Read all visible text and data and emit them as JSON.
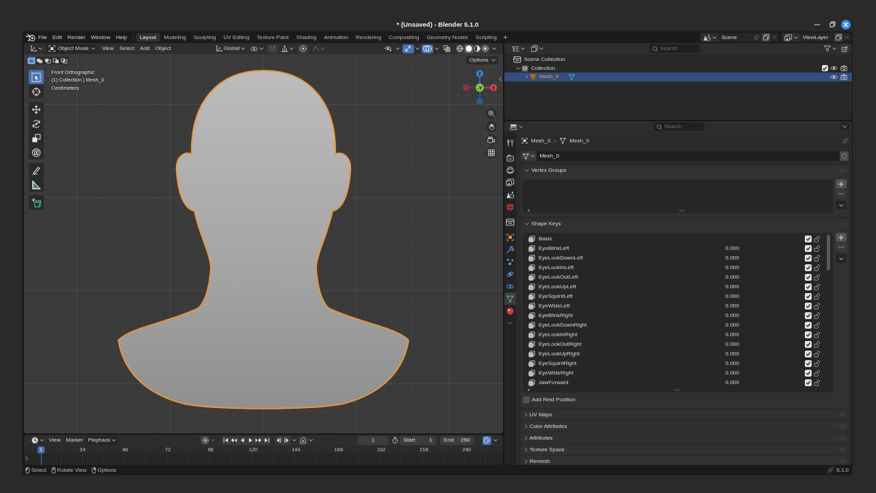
{
  "window": {
    "title": "* (Unsaved) - Blender 5.1.0"
  },
  "topbar": {
    "menus": [
      "File",
      "Edit",
      "Render",
      "Window",
      "Help"
    ],
    "workspaces": [
      {
        "label": "Layout",
        "selected": true
      },
      {
        "label": "Modeling",
        "selected": false
      },
      {
        "label": "Sculpting",
        "selected": false
      },
      {
        "label": "UV Editing",
        "selected": false
      },
      {
        "label": "Texture Paint",
        "selected": false
      },
      {
        "label": "Shading",
        "selected": false
      },
      {
        "label": "Animation",
        "selected": false
      },
      {
        "label": "Rendering",
        "selected": false
      },
      {
        "label": "Compositing",
        "selected": false
      },
      {
        "label": "Geometry Nodes",
        "selected": false
      },
      {
        "label": "Scripting",
        "selected": false
      }
    ],
    "add_tab": "+",
    "scene": "Scene",
    "view_layer": "ViewLayer"
  },
  "viewport": {
    "mode": "Object Mode",
    "menus": [
      "View",
      "Select",
      "Add",
      "Object"
    ],
    "orientation": "Global",
    "toggles": [
      {
        "kind": "selectability",
        "on": false
      },
      {
        "kind": "gizmos",
        "on": true
      },
      {
        "kind": "overlays",
        "on": true
      },
      {
        "kind": "xray",
        "on": false
      }
    ],
    "shading": [
      {
        "kind": "wireframe",
        "selected": false
      },
      {
        "kind": "solid",
        "selected": true
      },
      {
        "kind": "material",
        "selected": false
      },
      {
        "kind": "rendered",
        "selected": false
      }
    ],
    "select_modes": [
      {
        "kind": "set",
        "selected": true
      },
      {
        "kind": "extend",
        "selected": false
      },
      {
        "kind": "subtract",
        "selected": false
      },
      {
        "kind": "invert",
        "selected": false
      },
      {
        "kind": "intersect",
        "selected": false
      }
    ],
    "options": "Options",
    "info": [
      "Front Orthographic",
      "(1) Collection | Mesh_0",
      "Centimeters"
    ],
    "tools": [
      {
        "kind": "select_box",
        "selected": true
      },
      {
        "kind": "cursor",
        "selected": false
      },
      {
        "kind": "move",
        "selected": false
      },
      {
        "kind": "rotate",
        "selected": false
      },
      {
        "kind": "scale",
        "selected": false
      },
      {
        "kind": "transform",
        "selected": false
      },
      {
        "kind": "annotate",
        "selected": false
      },
      {
        "kind": "measure",
        "selected": false
      },
      {
        "kind": "add_cube",
        "selected": false
      }
    ],
    "axes": [
      {
        "kind": "up",
        "label": "Z",
        "color": "#3d86d8"
      },
      {
        "kind": "left",
        "color": "#8e3242"
      },
      {
        "kind": "center",
        "label": "-Y",
        "color": "#8cc63f"
      },
      {
        "kind": "right",
        "label": "X",
        "color": "#e0455a"
      },
      {
        "kind": "down",
        "color": "#2d5b95"
      }
    ]
  },
  "outliner": {
    "search": {
      "placeholder": "Search"
    },
    "tree": [
      {
        "kind": "scene_collection",
        "label": "Scene Collection",
        "selected": false,
        "children": [
          {
            "kind": "collection",
            "label": "Collection",
            "expanded": true,
            "checked": true,
            "selected": false,
            "children": [
              {
                "kind": "mesh_object",
                "label": "Mesh_0",
                "expanded": false,
                "selected": true
              }
            ]
          }
        ]
      }
    ]
  },
  "properties": {
    "search": {
      "placeholder": "Search"
    },
    "tabs": [
      {
        "kind": "tool",
        "selected": false
      },
      {
        "kind": "render",
        "selected": false
      },
      {
        "kind": "output",
        "selected": false
      },
      {
        "kind": "view_layer",
        "selected": false
      },
      {
        "kind": "scene",
        "selected": false
      },
      {
        "kind": "world",
        "selected": false
      },
      {
        "kind": "collection",
        "selected": false
      },
      {
        "kind": "object",
        "selected": false
      },
      {
        "kind": "modifiers",
        "selected": false
      },
      {
        "kind": "particles",
        "selected": false
      },
      {
        "kind": "physics",
        "selected": false
      },
      {
        "kind": "constraints",
        "selected": false
      },
      {
        "kind": "data",
        "selected": true
      },
      {
        "kind": "material",
        "selected": false
      }
    ],
    "breadcrumb": [
      "Mesh_0",
      "Mesh_0"
    ],
    "datablock": "Mesh_0",
    "panels": [
      {
        "title": "Vertex Groups",
        "expanded": true,
        "kind": "list"
      },
      {
        "title": "Shape Keys",
        "expanded": true,
        "kind": "list",
        "items": [
          {
            "name": "Basis",
            "checked": true,
            "locked": false
          },
          {
            "name": "EyeBlinkLeft",
            "value": "0.000",
            "checked": true,
            "locked": false
          },
          {
            "name": "EyeLookDownLeft",
            "value": "0.000",
            "checked": true,
            "locked": false
          },
          {
            "name": "EyeLookInLeft",
            "value": "0.000",
            "checked": true,
            "locked": false
          },
          {
            "name": "EyeLookOutLeft",
            "value": "0.000",
            "checked": true,
            "locked": false
          },
          {
            "name": "EyeLookUpLeft",
            "value": "0.000",
            "checked": true,
            "locked": false
          },
          {
            "name": "EyeSquintLeft",
            "value": "0.000",
            "checked": true,
            "locked": false
          },
          {
            "name": "EyeWideLeft",
            "value": "0.000",
            "checked": true,
            "locked": false
          },
          {
            "name": "EyeBlinkRight",
            "value": "0.000",
            "checked": true,
            "locked": false
          },
          {
            "name": "EyeLookDownRight",
            "value": "0.000",
            "checked": true,
            "locked": false
          },
          {
            "name": "EyeLookInRight",
            "value": "0.000",
            "checked": true,
            "locked": false
          },
          {
            "name": "EyeLookOutRight",
            "value": "0.000",
            "checked": true,
            "locked": false
          },
          {
            "name": "EyeLookUpRight",
            "value": "0.000",
            "checked": true,
            "locked": false
          },
          {
            "name": "EyeSquintRight",
            "value": "0.000",
            "checked": true,
            "locked": false
          },
          {
            "name": "EyeWideRight",
            "value": "0.000",
            "checked": true,
            "locked": false
          },
          {
            "name": "JawForward",
            "value": "0.000",
            "checked": true,
            "locked": false
          }
        ],
        "option": {
          "label": "Add Rest Position",
          "checked": false
        }
      },
      {
        "title": "UV Maps",
        "expanded": false
      },
      {
        "title": "Color Attributes",
        "expanded": false
      },
      {
        "title": "Attributes",
        "expanded": false
      },
      {
        "title": "Texture Space",
        "expanded": false
      },
      {
        "title": "Remesh",
        "expanded": false
      }
    ]
  },
  "timeline": {
    "menus": [
      "View",
      "Marker"
    ],
    "playback": "Playback",
    "frame": "1",
    "start_label": "Start",
    "start": "1",
    "end_label": "End",
    "end": "250",
    "playhead": "1",
    "ruler": [
      "24",
      "48",
      "72",
      "96",
      "120",
      "144",
      "168",
      "192",
      "216",
      "240"
    ]
  },
  "status_bar": {
    "hints": [
      "Select",
      "Rotate View",
      "Options"
    ],
    "version": "5.1.0"
  }
}
